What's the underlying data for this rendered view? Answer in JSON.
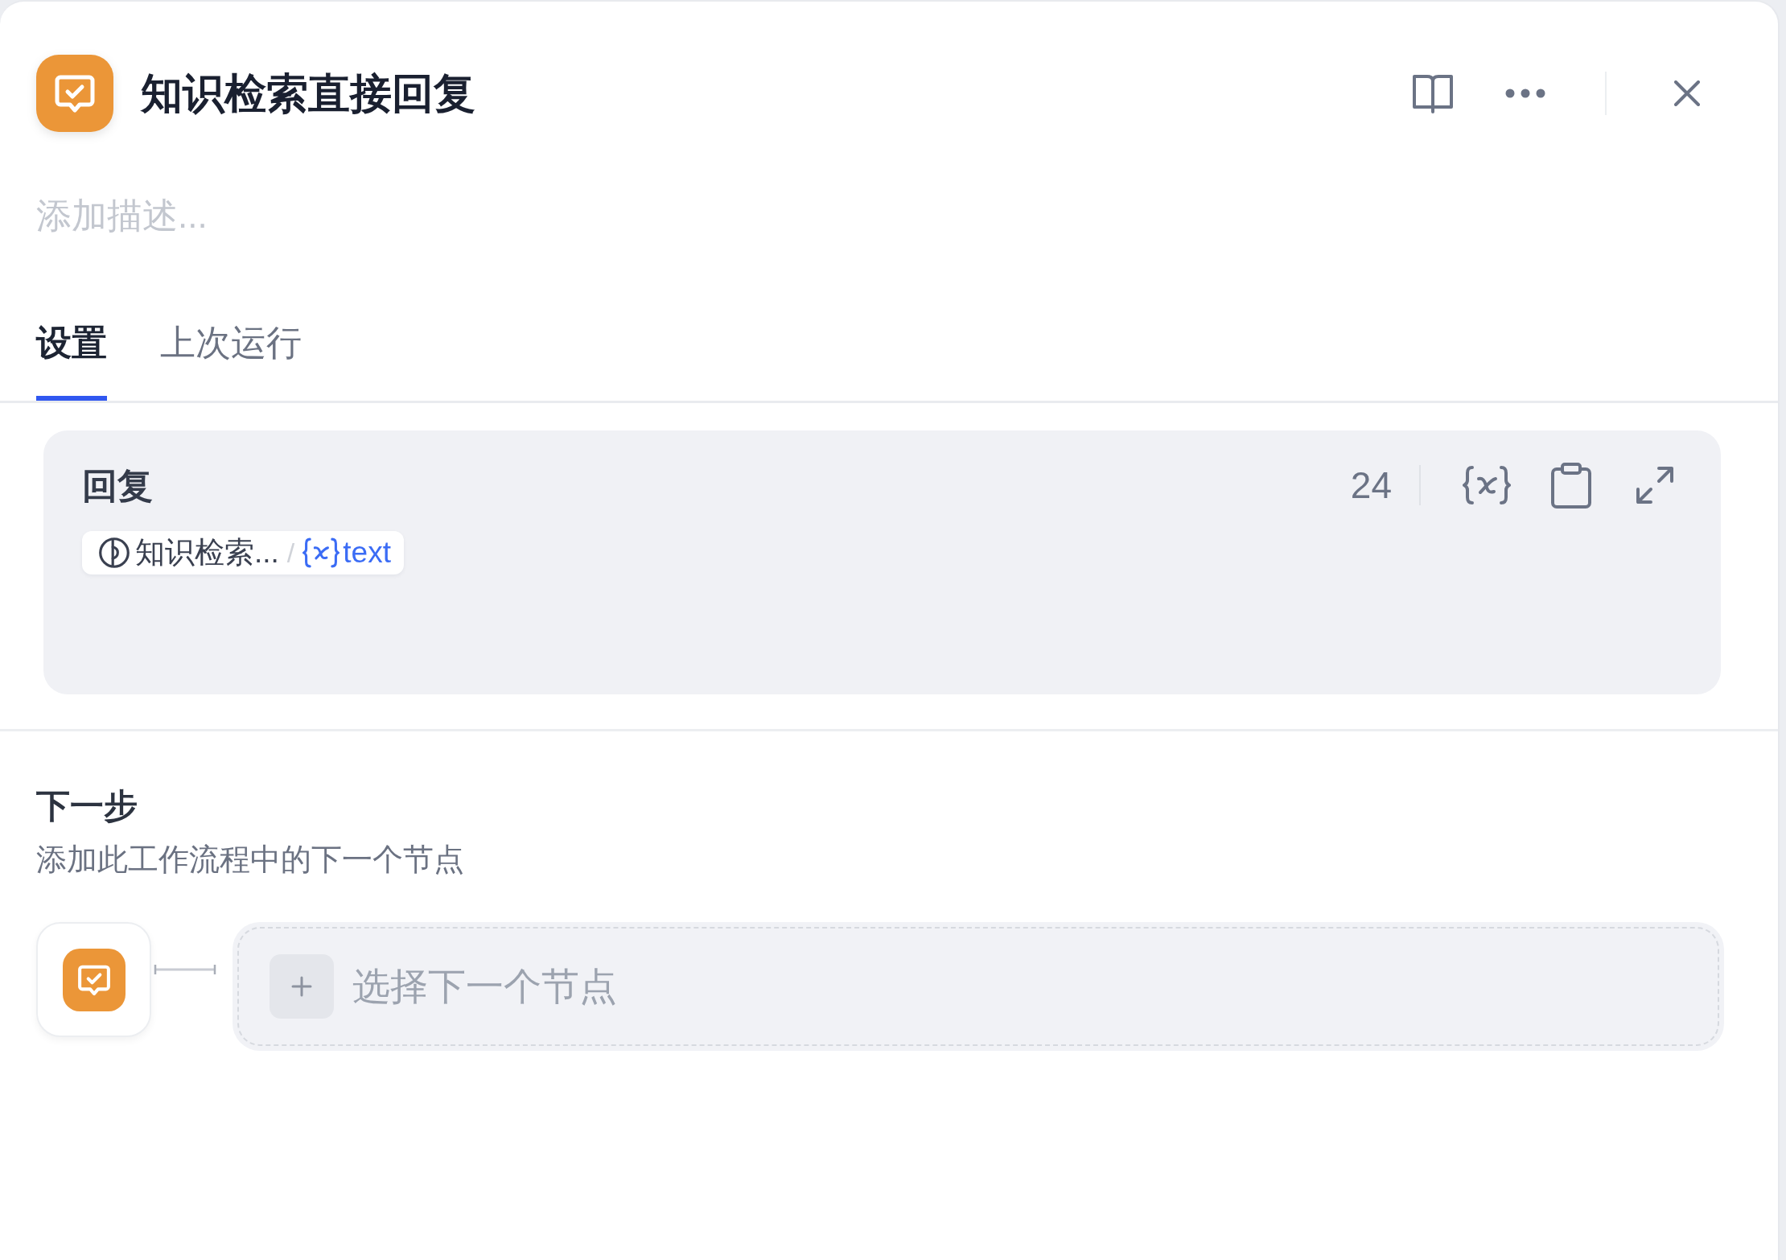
{
  "header": {
    "title": "知识检索直接回复"
  },
  "description": {
    "placeholder": "添加描述..."
  },
  "tabs": [
    {
      "label": "设置",
      "selected": true
    },
    {
      "label": "上次运行",
      "selected": false
    }
  ],
  "reply": {
    "label": "回复",
    "char_count": "24",
    "references": [
      {
        "node": "知识检索...",
        "separator": "/",
        "variable": "text"
      }
    ]
  },
  "next_step": {
    "title": "下一步",
    "subtitle": "添加此工作流程中的下一个节点",
    "select_button": {
      "label": "选择下一个节点"
    }
  }
}
